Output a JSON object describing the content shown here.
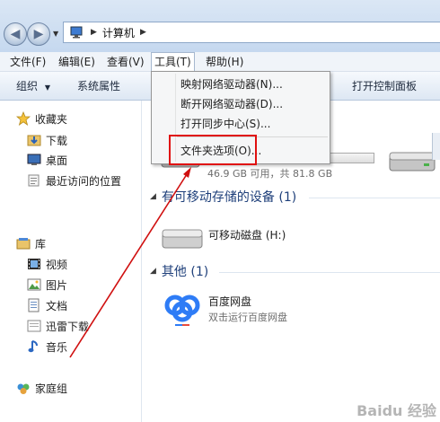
{
  "address": {
    "path": "计算机"
  },
  "menubar": {
    "items": [
      {
        "label": "文件(F)"
      },
      {
        "label": "编辑(E)"
      },
      {
        "label": "查看(V)"
      },
      {
        "label": "工具(T)"
      },
      {
        "label": "帮助(H)"
      }
    ]
  },
  "toolbar": {
    "organize": "组织",
    "system_properties": "系统属性",
    "open_control_panel": "打开控制面板"
  },
  "tools_menu": {
    "items": [
      {
        "label": "映射网络驱动器(N)..."
      },
      {
        "label": "断开网络驱动器(D)..."
      },
      {
        "label": "打开同步中心(S)..."
      },
      {
        "label": "文件夹选项(O)..."
      }
    ]
  },
  "sidebar": {
    "favorites_label": "收藏夹",
    "favorites": [
      {
        "label": "下载"
      },
      {
        "label": "桌面"
      },
      {
        "label": "最近访问的位置"
      }
    ],
    "libraries_label": "库",
    "libraries": [
      {
        "label": "视频"
      },
      {
        "label": "图片"
      },
      {
        "label": "文档"
      },
      {
        "label": "迅雷下载"
      },
      {
        "label": "音乐"
      }
    ],
    "homegroup_label": "家庭组"
  },
  "main": {
    "hard_disk": {
      "free_text": "46.9 GB 可用，共 81.8 GB",
      "used_fraction": 0.43
    },
    "removable_group": {
      "title": "有可移动存储的设备 (1)"
    },
    "removable_disk": {
      "name": "可移动磁盘 (H:)"
    },
    "other_group": {
      "title": "其他 (1)"
    },
    "baidu": {
      "name": "百度网盘",
      "sub": "双击运行百度网盘"
    }
  },
  "watermark": "Baidu 经验"
}
